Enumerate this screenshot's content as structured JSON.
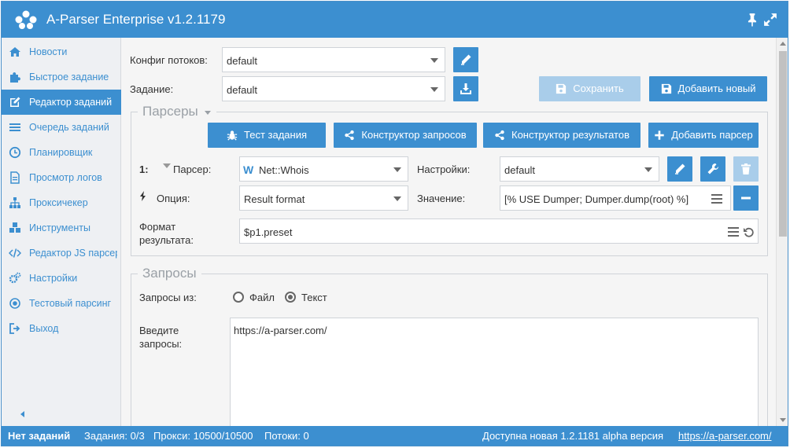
{
  "window": {
    "title": "A-Parser Enterprise v1.2.1179"
  },
  "colors": {
    "accent": "#3c8fd0",
    "accent_disabled": "#a9cdea",
    "nav_bg": "#eef0f3"
  },
  "sidebar": {
    "items": [
      {
        "label": "Новости",
        "icon": "home-icon"
      },
      {
        "label": "Быстрое задание",
        "icon": "puzzle-icon"
      },
      {
        "label": "Редактор заданий",
        "icon": "pencil-square-icon",
        "active": true
      },
      {
        "label": "Очередь заданий",
        "icon": "list-icon"
      },
      {
        "label": "Планировщик",
        "icon": "clock-icon"
      },
      {
        "label": "Просмотр логов",
        "icon": "file-text-icon"
      },
      {
        "label": "Проксичекер",
        "icon": "sitemap-icon"
      },
      {
        "label": "Инструменты",
        "icon": "cubes-icon"
      },
      {
        "label": "Редактор JS парсеров",
        "icon": "code-icon"
      },
      {
        "label": "Настройки",
        "icon": "gears-icon"
      },
      {
        "label": "Тестовый парсинг",
        "icon": "target-icon"
      },
      {
        "label": "Выход",
        "icon": "sign-out-icon"
      }
    ]
  },
  "form": {
    "thread_config_label": "Конфиг потоков:",
    "thread_config_value": "default",
    "task_label": "Задание:",
    "task_value": "default",
    "save_label": "Сохранить",
    "add_new_label": "Добавить новый"
  },
  "parsers": {
    "legend": "Парсеры",
    "test_task_label": "Тест задания",
    "query_builder_label": "Конструктор запросов",
    "result_builder_label": "Конструктор результатов",
    "add_parser_label": "Добавить парсер",
    "row_index": "1:",
    "parser_label": "Парсер:",
    "parser_value": "Net::Whois",
    "settings_label": "Настройки:",
    "settings_value": "default",
    "option_label": "Опция:",
    "option_value": "Result format",
    "value_label": "Значение:",
    "value_value": "[% USE Dumper; Dumper.dump(root) %]",
    "result_format_label_1": "Формат",
    "result_format_label_2": "результата:",
    "result_format_value": "$p1.preset"
  },
  "queries": {
    "legend": "Запросы",
    "from_label": "Запросы из:",
    "option_file": "Файл",
    "option_text": "Текст",
    "selected": "Текст",
    "enter_label_1": "Введите",
    "enter_label_2": "запросы:",
    "text": "https://a-parser.com/"
  },
  "status": {
    "no_tasks": "Нет заданий",
    "tasks": "Задания: 0/3",
    "proxies": "Прокси: 10500/10500",
    "threads": "Потоки: 0",
    "update_text": "Доступна новая 1.2.1181 alpha версия",
    "update_link": "https://a-parser.com/"
  }
}
